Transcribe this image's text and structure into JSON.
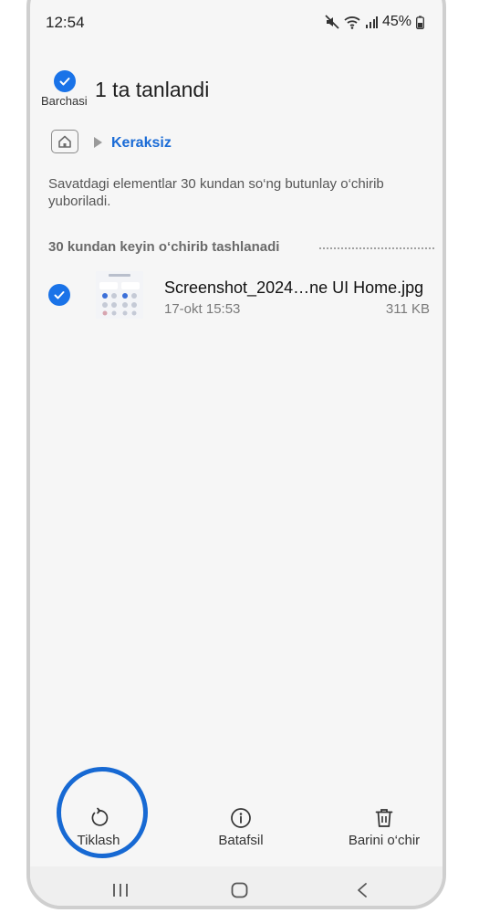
{
  "status_bar": {
    "time": "12:54",
    "battery": "45%",
    "icons": [
      "mute-icon",
      "wifi-icon",
      "signal-icon",
      "battery-icon"
    ]
  },
  "header": {
    "select_all_label": "Barchasi",
    "title": "1 ta tanlandi"
  },
  "breadcrumb": {
    "home_icon": "home-icon",
    "current": "Keraksiz"
  },
  "info_text": "Savatdagi elementlar 30 kundan so‘ng butunlay o‘chirib yuboriladi.",
  "section": {
    "title": "30 kundan keyin o‘chirib tashlanadi"
  },
  "files": [
    {
      "name": "Screenshot_2024…ne UI Home.jpg",
      "date": "17-okt 15:53",
      "size": "311 KB",
      "selected": true
    }
  ],
  "toolbar": {
    "restore_label": "Tiklash",
    "details_label": "Batafsil",
    "delete_all_label": "Barini o‘chir"
  },
  "colors": {
    "accent": "#1a73e8",
    "highlight": "#1769d3",
    "link": "#1a6bd6"
  }
}
